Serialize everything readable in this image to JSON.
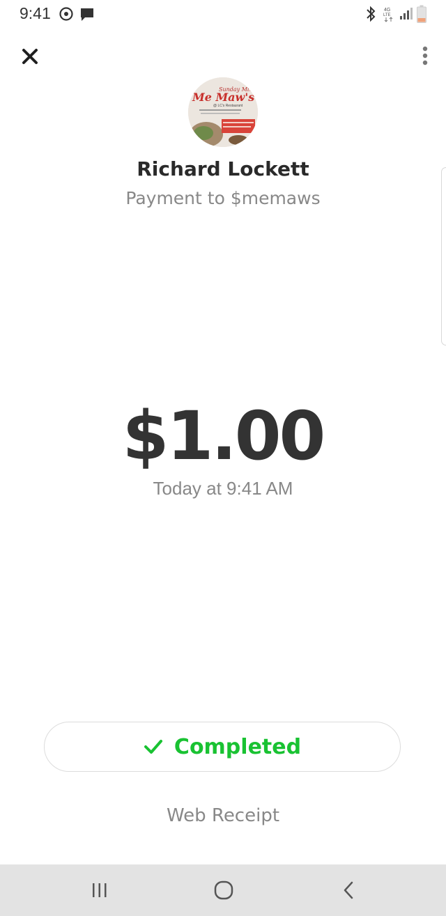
{
  "status_bar": {
    "time": "9:41",
    "left_icons": [
      "sync-icon",
      "message-icon"
    ],
    "right_icons": [
      "bluetooth-icon",
      "4g-lte-icon",
      "signal-icon",
      "battery-icon"
    ],
    "network_label": "4G LTE",
    "battery_color": "#f0a27a"
  },
  "header": {
    "close_icon": "close-icon",
    "menu_icon": "more-vertical-icon"
  },
  "payment": {
    "name": "Richard Lockett",
    "subtitle": "Payment to $memaws",
    "amount": "$1.00",
    "datetime": "Today at 9:41 AM",
    "avatar_text": {
      "line1": "Sunday Mix",
      "line2": "Me Maw's",
      "line3": "@ LC's Restaurant"
    }
  },
  "status": {
    "label": "Completed",
    "icon": "checkmark-icon",
    "color": "#19c232"
  },
  "links": {
    "web_receipt": "Web Receipt"
  },
  "nav": {
    "items": [
      "recent-apps-icon",
      "home-icon",
      "back-icon"
    ]
  },
  "colors": {
    "text_primary": "#2a2a2a",
    "text_secondary": "#888888",
    "accent_green": "#19c232",
    "nav_bg": "#e3e3e3"
  }
}
